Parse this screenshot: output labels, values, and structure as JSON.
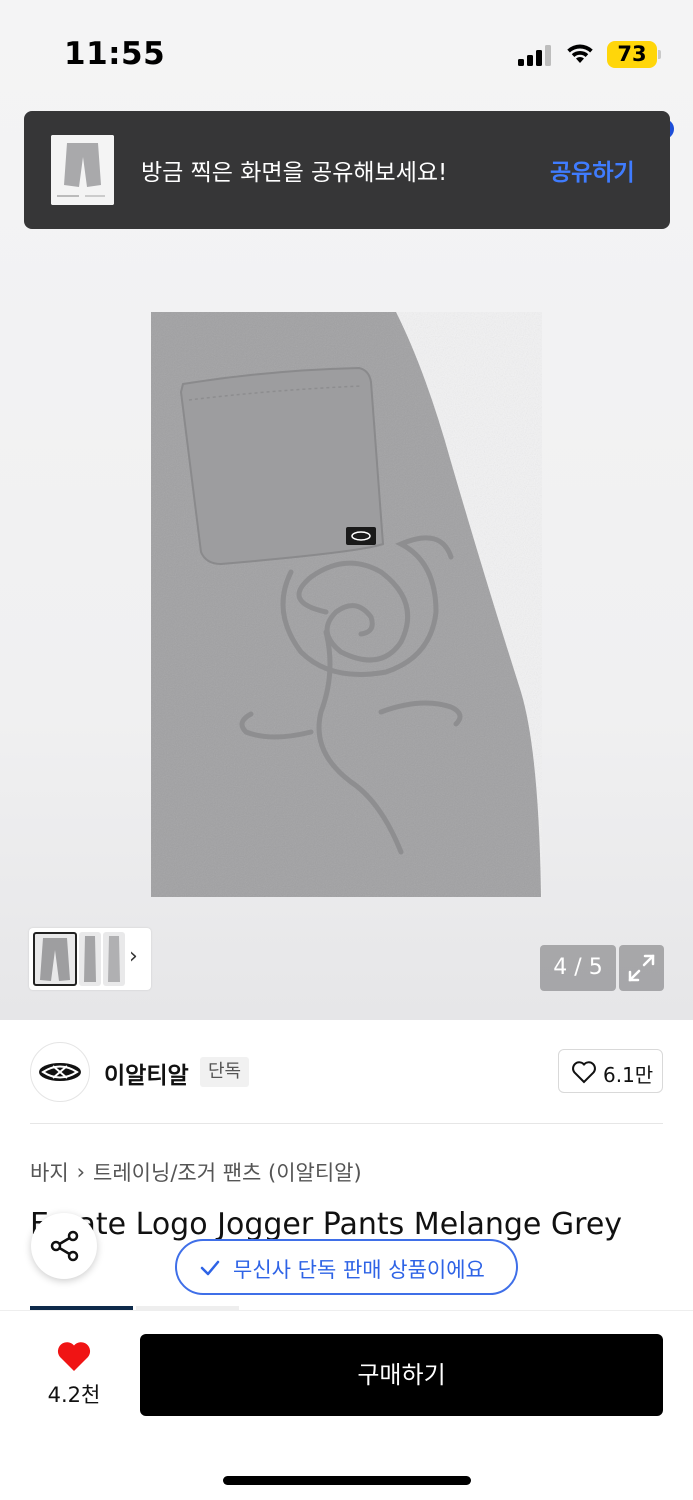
{
  "status_bar": {
    "time": "11:55",
    "battery": "73"
  },
  "toast": {
    "message": "방금 찍은 화면을 공유해보세요!",
    "action": "공유하기"
  },
  "gallery": {
    "counter": "4 / 5"
  },
  "brand": {
    "name": "이알티알",
    "tag": "단독",
    "likes": "6.1만"
  },
  "breadcrumb": {
    "category": "바지",
    "subcategory": "트레이닝/조거 팬츠 (이알티알)"
  },
  "product": {
    "title": "E  nate Logo Jogger Pants Melange Grey"
  },
  "badge": {
    "exclusive": "무신사 단독 판매 상품이에요"
  },
  "bottom_bar": {
    "wish_count": "4.2천",
    "buy_label": "구매하기"
  },
  "colors": {
    "accent_blue": "#2e63e6",
    "heart_red": "#f01414",
    "toast_bg": "#363637",
    "buy_bg": "#000000"
  }
}
